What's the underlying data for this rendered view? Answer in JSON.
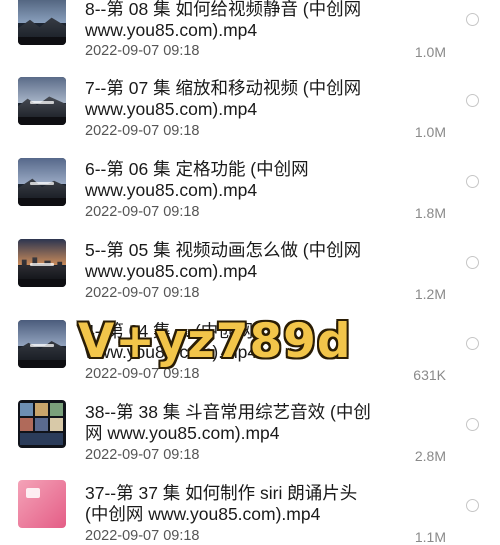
{
  "files": [
    {
      "title_line1": "8--第 08 集 如何给视频静音 (中创网",
      "title_line2": "www.you85.com).mp4",
      "date": "2022-09-07 09:18",
      "size": "1.0M",
      "thumb": "mountain-dusk"
    },
    {
      "title_line1": "7--第 07 集 缩放和移动视频 (中创网",
      "title_line2": "www.you85.com).mp4",
      "date": "2022-09-07 09:18",
      "size": "1.0M",
      "thumb": "mountain-dusk"
    },
    {
      "title_line1": "6--第 06 集 定格功能 (中创网",
      "title_line2": "www.you85.com).mp4",
      "date": "2022-09-07 09:18",
      "size": "1.8M",
      "thumb": "mountain-dusk"
    },
    {
      "title_line1": "5--第 05 集 视频动画怎么做 (中创网",
      "title_line2": "www.you85.com).mp4",
      "date": "2022-09-07 09:18",
      "size": "1.2M",
      "thumb": "city-sunset"
    },
    {
      "title_line1": "4--第 04 集 ... (中创网",
      "title_line2": "www.you85.com).mp4",
      "date": "2022-09-07 09:18",
      "size": "631K",
      "thumb": "mountain-dusk"
    },
    {
      "title_line1": "38--第 38 集 斗音常用综艺音效 (中创",
      "title_line2": "网 www.you85.com).mp4",
      "date": "2022-09-07 09:18",
      "size": "2.8M",
      "thumb": "photo-grid"
    },
    {
      "title_line1": "37--第 37 集 如何制作 siri 朗诵片头",
      "title_line2": "(中创网 www.you85.com).mp4",
      "date": "2022-09-07 09:18",
      "size": "1.1M",
      "thumb": "pink-app"
    }
  ],
  "watermark": "V+yz789d",
  "colors": {
    "title": "#1a1a1a",
    "date": "#555555",
    "size": "#8a8a8a",
    "watermark": "#f2c54a"
  }
}
